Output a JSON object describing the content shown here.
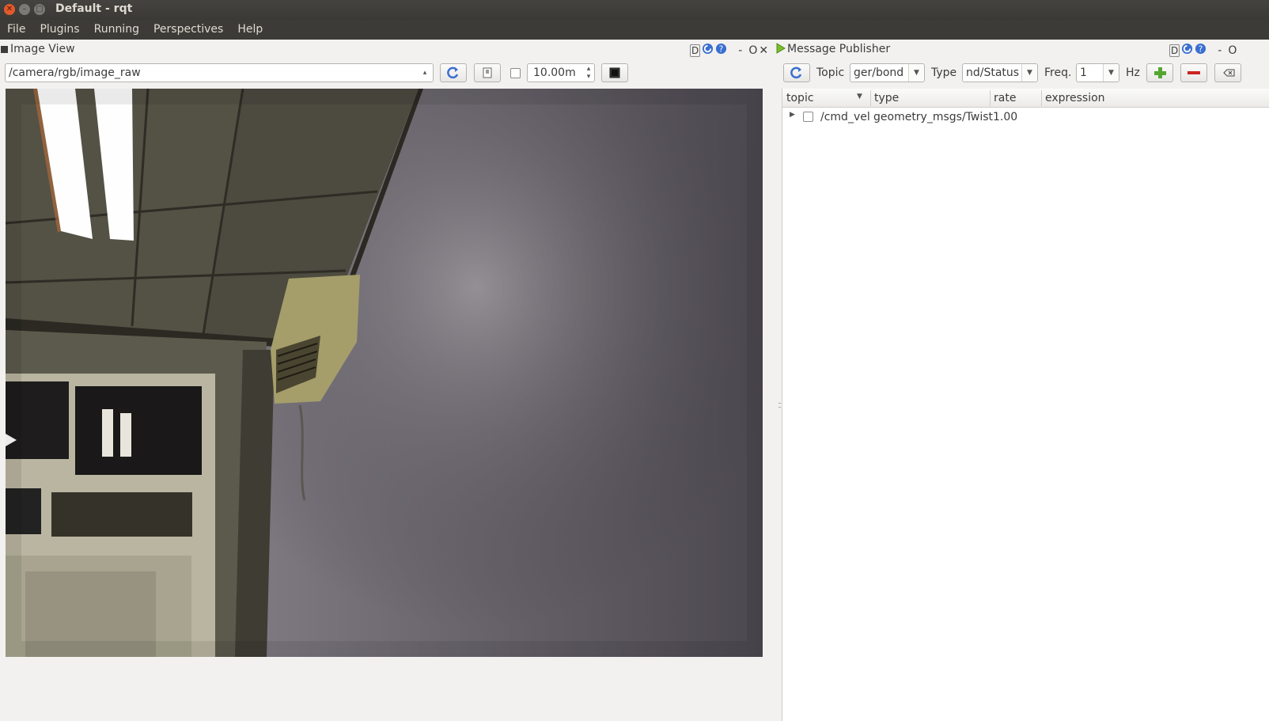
{
  "window": {
    "title": "Default - rqt"
  },
  "menu": [
    {
      "label": "File"
    },
    {
      "label": "Plugins"
    },
    {
      "label": "Running"
    },
    {
      "label": "Perspectives"
    },
    {
      "label": "Help"
    }
  ],
  "image_view": {
    "title": "Image View",
    "topic": "/camera/rgb/image_raw",
    "zoom": "10.00m",
    "dock_controls": {
      "d": "D",
      "minimize": "-",
      "float": "O",
      "close": "✕"
    }
  },
  "message_publisher": {
    "title": "Message Publisher",
    "topic_label": "Topic",
    "topic_value": "ger/bond",
    "type_label": "Type",
    "type_value": "nd/Status",
    "freq_label": "Freq.",
    "freq_value": "1",
    "hz_label": "Hz",
    "dock_controls": {
      "d": "D",
      "minimize": "-",
      "float": "O"
    },
    "columns": [
      "topic",
      "type",
      "rate",
      "expression"
    ],
    "rows": [
      {
        "topic": "/cmd_vel",
        "type": "geometry_msgs/Twist",
        "rate": "1.00",
        "expression": ""
      }
    ]
  },
  "colors": {
    "titlebar": "#3a3935",
    "close_button": "#e25a2c",
    "add_button": "#55a630",
    "remove_button": "#cc2222",
    "refresh_icon": "#3a6fd0"
  }
}
